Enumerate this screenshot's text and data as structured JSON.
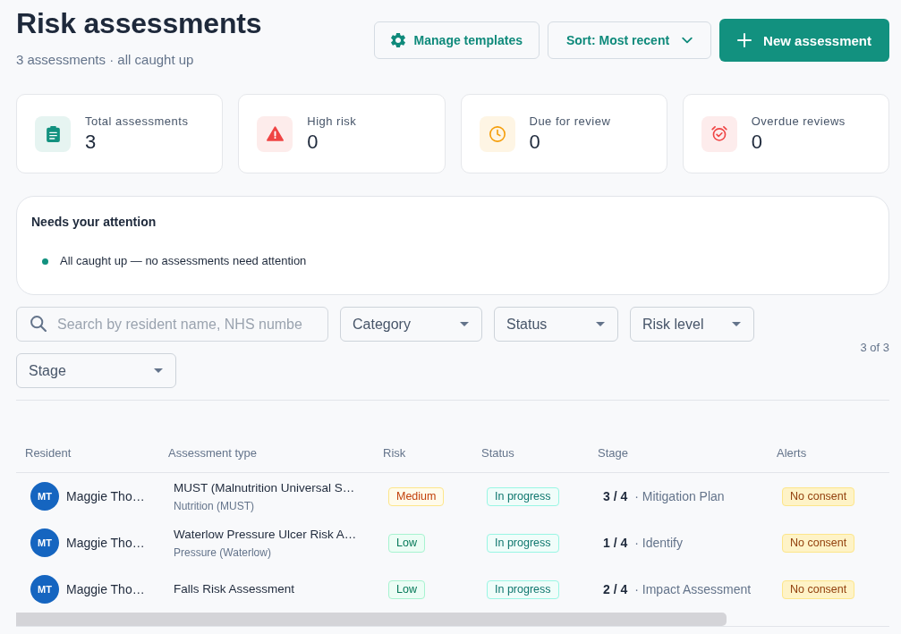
{
  "header": {
    "title": "Risk assessments",
    "subtitle": "3 assessments · all caught up",
    "actions": [
      {
        "label": "Manage templates",
        "kind": "templates"
      },
      {
        "label": "Sort: Most recent",
        "kind": "sort"
      },
      {
        "label": "New assessment",
        "kind": "primary"
      }
    ]
  },
  "stats": [
    {
      "label": "Total assessments",
      "value": "3",
      "kind": "total"
    },
    {
      "label": "High risk",
      "value": "0",
      "kind": "high"
    },
    {
      "label": "Due for review",
      "value": "0",
      "kind": "due"
    },
    {
      "label": "Overdue reviews",
      "value": "0",
      "kind": "overdue"
    }
  ],
  "attention": {
    "title": "Needs your attention",
    "items": [
      "All caught up — no assessments need attention"
    ]
  },
  "filters": {
    "search": {
      "placeholder": "Search by resident name, NHS numbe"
    },
    "dropdowns": [
      "Category",
      "Status",
      "Risk level",
      "Stage"
    ],
    "count": "3 of 3"
  },
  "table": {
    "columns": [
      "Resident",
      "Assessment type",
      "Risk",
      "Status",
      "Stage",
      "Alerts"
    ],
    "rows": [
      {
        "resident": {
          "initials": "MT",
          "name": "Maggie Tho…"
        },
        "assessment": {
          "title": "MUST (Malnutrition Universal S…",
          "category": "Nutrition (MUST)"
        },
        "risk": {
          "label": "Medium",
          "kind": "medium"
        },
        "status": "In progress",
        "stage": {
          "step": "3 / 4",
          "name": "· Mitigation Plan"
        },
        "alert": "No consent"
      },
      {
        "resident": {
          "initials": "MT",
          "name": "Maggie Tho…"
        },
        "assessment": {
          "title": "Waterlow Pressure Ulcer Risk A…",
          "category": "Pressure (Waterlow)"
        },
        "risk": {
          "label": "Low",
          "kind": "low"
        },
        "status": "In progress",
        "stage": {
          "step": "1 / 4",
          "name": "· Identify"
        },
        "alert": "No consent"
      },
      {
        "resident": {
          "initials": "MT",
          "name": "Maggie Tho…"
        },
        "assessment": {
          "title": "Falls Risk Assessment"
        },
        "risk": {
          "label": "Low",
          "kind": "low"
        },
        "status": "In progress",
        "stage": {
          "step": "2 / 4",
          "name": "· Impact Assessment"
        },
        "alert": "No consent"
      }
    ]
  }
}
